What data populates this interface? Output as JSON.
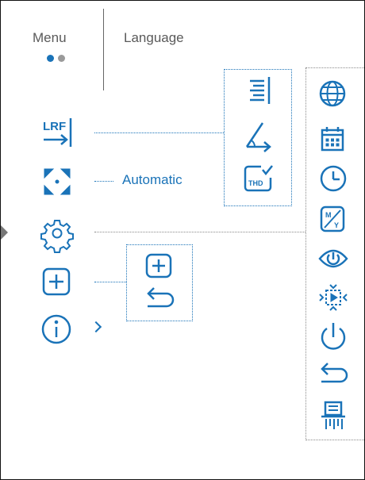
{
  "tabs": [
    {
      "label": "Menu"
    },
    {
      "label": "Language"
    }
  ],
  "page_dots": {
    "count": 2,
    "active": 0
  },
  "accent_color": "#1a73b8",
  "menu": {
    "items": [
      {
        "id": "lrf",
        "icon": "lrf-icon",
        "label": "LRF"
      },
      {
        "id": "mode",
        "icon": "crosshair-arrows-icon",
        "value": "Automatic"
      },
      {
        "id": "settings",
        "icon": "gear-icon"
      },
      {
        "id": "add",
        "icon": "plus-square-icon"
      },
      {
        "id": "info",
        "icon": "info-circle-icon"
      }
    ]
  },
  "lrf_submenu": [
    "list-align-icon",
    "angle-icon",
    "thd-icon"
  ],
  "lrf_submenu_thd_label": "THD",
  "add_submenu": [
    "plus-square-icon",
    "return-arrow-icon"
  ],
  "settings_submenu": [
    "globe-icon",
    "calendar-icon",
    "clock-icon",
    "units-mw-icon",
    "power-eye-icon",
    "pixel-calibration-icon",
    "power-icon",
    "return-arrow-icon",
    "shredder-icon"
  ]
}
